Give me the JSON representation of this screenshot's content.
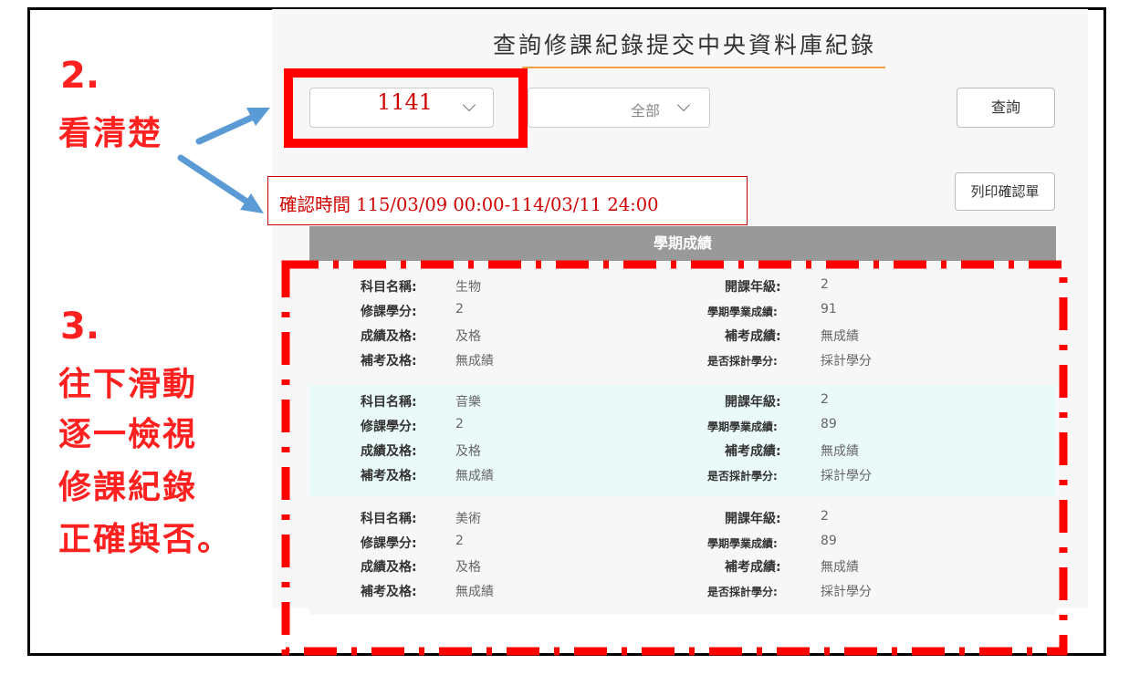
{
  "page": {
    "title": "查詢修課紀錄提交中央資料庫紀錄",
    "year_select": "1141",
    "filter_select": "全部",
    "query_button": "查詢",
    "print_button": "列印確認單",
    "confirm_time": "確認時間 115/03/09  00:00-114/03/11 24:00",
    "grades_header": "學期成績"
  },
  "labels": {
    "subject": "科目名稱:",
    "credits": "修課學分:",
    "passed": "成績及格:",
    "makeup_passed": "補考及格:",
    "grade_year": "開課年級:",
    "semester_score": "學期學業成績:",
    "makeup_score": "補考成績:",
    "credit_counted": "是否採計學分:"
  },
  "courses": [
    {
      "subject": "生物",
      "credits": "2",
      "passed": "及格",
      "makeup_passed": "無成績",
      "grade_year": "2",
      "semester_score": "91",
      "makeup_score": "無成績",
      "credit_counted": "採計學分"
    },
    {
      "subject": "音樂",
      "credits": "2",
      "passed": "及格",
      "makeup_passed": "無成績",
      "grade_year": "2",
      "semester_score": "89",
      "makeup_score": "無成績",
      "credit_counted": "採計學分"
    },
    {
      "subject": "美術",
      "credits": "2",
      "passed": "及格",
      "makeup_passed": "無成績",
      "grade_year": "2",
      "semester_score": "89",
      "makeup_score": "無成績",
      "credit_counted": "採計學分"
    }
  ],
  "annotations": {
    "step2_number": "2.",
    "step2_text": "看清楚",
    "step3_number": "3.",
    "step3_lines": [
      "往下滑動",
      "逐一檢視",
      "修課紀錄",
      "正確與否。"
    ]
  },
  "colors": {
    "annotation_red": "#ff0000",
    "arrow_blue": "#5b9bd5",
    "title_underline": "#f0a040",
    "header_gray": "#999999",
    "row_highlight": "#eafaf9"
  }
}
